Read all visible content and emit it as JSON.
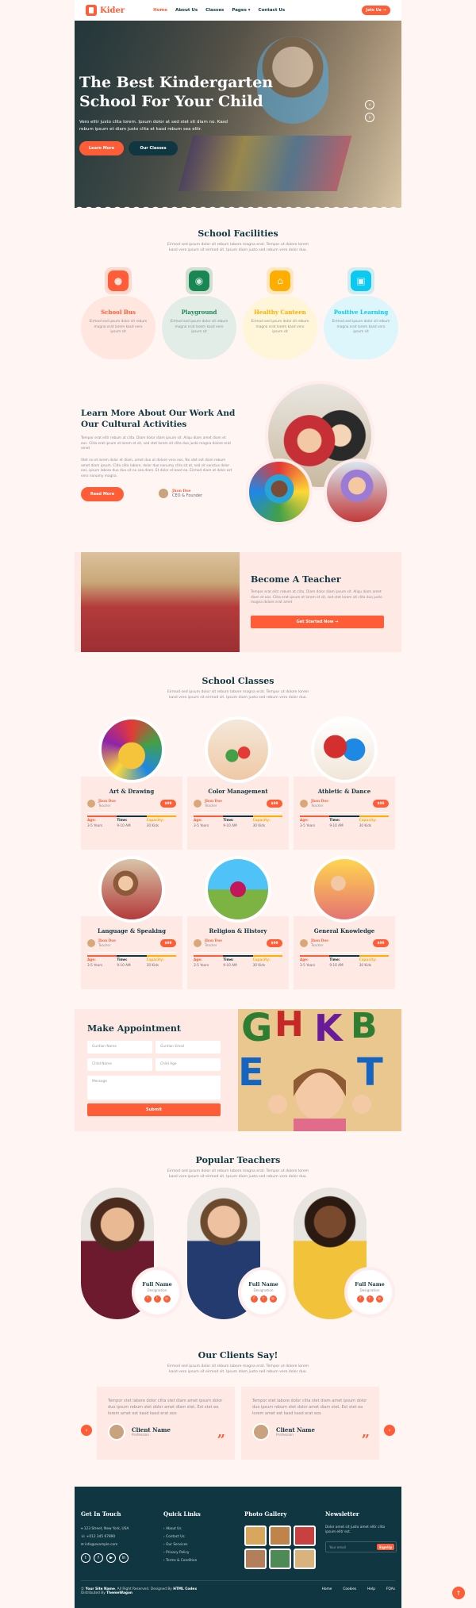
{
  "nav": {
    "brand": "Kider",
    "links": [
      "Home",
      "About Us",
      "Classes",
      "Pages ▾",
      "Contact Us"
    ],
    "join": "Join Us →"
  },
  "hero": {
    "title": "The Best Kindergarten School For Your Child",
    "text": "Vero elitr justo clita lorem. Ipsum dolor at sed stet sit diam no. Kasd rebum ipsum et diam justo clita et kasd rebum sea elitr.",
    "btn_primary": "Learn More",
    "btn_secondary": "Our Classes",
    "prev": "‹",
    "next": "›"
  },
  "facilities": {
    "title": "School Facilities",
    "subtitle": "Eirmod sed ipsum dolor sit rebum labore magna erat. Tempor ut dolore lorem kasd vero ipsum sit eirmod sit. Ipsum diam justo sed rebum vero dolor duo.",
    "items": [
      {
        "name": "School Bus",
        "text": "Eirmod sed ipsum dolor sit rebum magna erat lorem kasd vero ipsum sit",
        "color": "#fe5d37",
        "bg": "#ffe6df"
      },
      {
        "name": "Playground",
        "text": "Eirmod sed ipsum dolor sit rebum magna erat lorem kasd vero ipsum sit",
        "color": "#198754",
        "bg": "#e3ede7"
      },
      {
        "name": "Healthy Canteen",
        "text": "Eirmod sed ipsum dolor sit rebum magna erat lorem kasd vero ipsum sit",
        "color": "#ffae00",
        "bg": "#fff6d9"
      },
      {
        "name": "Positive Learning",
        "text": "Eirmod sed ipsum dolor sit rebum magna erat lorem kasd vero ipsum sit",
        "color": "#0dcaf0",
        "bg": "#ddf6fb"
      }
    ]
  },
  "about": {
    "title": "Learn More About Our Work And Our Cultural Activities",
    "p1": "Tempor erat elitr rebum at clita. Diam dolor diam ipsum sit. Aliqu diam amet diam et eos. Clita erat ipsum et lorem et sit, sed stet lorem sit clita duo justo magna dolore erat amet",
    "p2": "Stet no et lorem dolor et diam, amet duo ut dolore vero eos. No stet est diam rebum amet diam ipsum. Clita clita labore, dolor duo nonumy clita sit at, sed sit sanctus dolor eos, ipsum labore duo duo sit no sea diam. Et dolor et kasd ea. Eirmod diam at dolor est vero nonumy magna.",
    "btn": "Read More",
    "ceo_name": "Jhon Doe",
    "ceo_role": "CEO & Founder"
  },
  "become": {
    "title": "Become A Teacher",
    "text": "Tempor erat elitr rebum at clita. Diam dolor diam ipsum sit. Aliqu diam amet diam et eos. Clita erat ipsum et lorem et sit, sed stet lorem sit clita duo justo magna dolore erat amet",
    "btn": "Get Started Now →"
  },
  "classes": {
    "title": "School Classes",
    "subtitle": "Eirmod sed ipsum dolor sit rebum labore magna erat. Tempor ut dolore lorem kasd vero ipsum sit eirmod sit. Ipsum diam justo sed rebum vero dolor duo.",
    "age_label": "Age:",
    "time_label": "Time:",
    "cap_label": "Capacity:",
    "items": [
      {
        "name": "Art & Drawing",
        "teacher": "Jhon Doe",
        "role": "Teacher",
        "price": "$99",
        "age": "3-5 Years",
        "time": "9-10 AM",
        "cap": "30 Kids"
      },
      {
        "name": "Color Management",
        "teacher": "Jhon Doe",
        "role": "Teacher",
        "price": "$99",
        "age": "3-5 Years",
        "time": "9-10 AM",
        "cap": "30 Kids"
      },
      {
        "name": "Athletic & Dance",
        "teacher": "Jhon Doe",
        "role": "Teacher",
        "price": "$99",
        "age": "3-5 Years",
        "time": "9-10 AM",
        "cap": "30 Kids"
      },
      {
        "name": "Language & Speaking",
        "teacher": "Jhon Doe",
        "role": "Teacher",
        "price": "$99",
        "age": "3-5 Years",
        "time": "9-10 AM",
        "cap": "30 Kids"
      },
      {
        "name": "Religion & History",
        "teacher": "Jhon Doe",
        "role": "Teacher",
        "price": "$99",
        "age": "3-5 Years",
        "time": "9-10 AM",
        "cap": "30 Kids"
      },
      {
        "name": "General Knowledge",
        "teacher": "Jhon Doe",
        "role": "Teacher",
        "price": "$99",
        "age": "3-5 Years",
        "time": "9-10 AM",
        "cap": "30 Kids"
      }
    ]
  },
  "appointment": {
    "title": "Make Appointment",
    "guardian_name": "Gurdian Name",
    "guardian_email": "Gurdian Email",
    "child_name": "Child Name",
    "child_age": "Child Age",
    "message": "Message",
    "submit": "Submit"
  },
  "teachers": {
    "title": "Popular Teachers",
    "subtitle": "Eirmod sed ipsum dolor sit rebum labore magna erat. Tempor ut dolore lorem kasd vero ipsum sit eirmod sit. Ipsum diam justo sed rebum vero dolor duo.",
    "items": [
      {
        "name": "Full Name",
        "designation": "Designation"
      },
      {
        "name": "Full Name",
        "designation": "Designation"
      },
      {
        "name": "Full Name",
        "designation": "Designation"
      }
    ]
  },
  "clients": {
    "title": "Our Clients Say!",
    "subtitle": "Eirmod sed ipsum dolor sit rebum labore magna erat. Tempor ut dolore lorem kasd vero ipsum sit eirmod sit. Ipsum diam justo sed rebum vero dolor duo.",
    "items": [
      {
        "text": "Tempor stet labore dolor clita stet diam amet ipsum dolor duo ipsum rebum stet dolor amet diam stet. Est stet ea lorem amet est kasd kasd erat eos",
        "name": "Client Name",
        "profession": "Profession"
      },
      {
        "text": "Tempor stet labore dolor clita stet diam amet ipsum dolor duo ipsum rebum stet dolor amet diam stet. Est stet ea lorem amet est kasd kasd erat eos",
        "name": "Client Name",
        "profession": "Profession"
      }
    ]
  },
  "footer": {
    "touch_title": "Get In Touch",
    "address": "123 Street, New York, USA",
    "phone": "+012 345 67890",
    "email": "info@example.com",
    "links_title": "Quick Links",
    "links": [
      "About Us",
      "Contact Us",
      "Our Services",
      "Privacy Policy",
      "Terms & Condition"
    ],
    "gallery_title": "Photo Gallery",
    "news_title": "Newsletter",
    "news_text": "Dolor amet sit justo amet elitr clita ipsum elitr est.",
    "news_placeholder": "Your email",
    "news_btn": "SignUp",
    "copy_a": "©",
    "copy_site": "Your Site Name",
    "copy_b": ", All Right Reserved. Designed By",
    "copy_designer": "HTML Codex",
    "dist_a": "Distributed By",
    "dist_b": "ThemeWagon",
    "menu": [
      "Home",
      "Cookies",
      "Help",
      "FQAs"
    ]
  }
}
